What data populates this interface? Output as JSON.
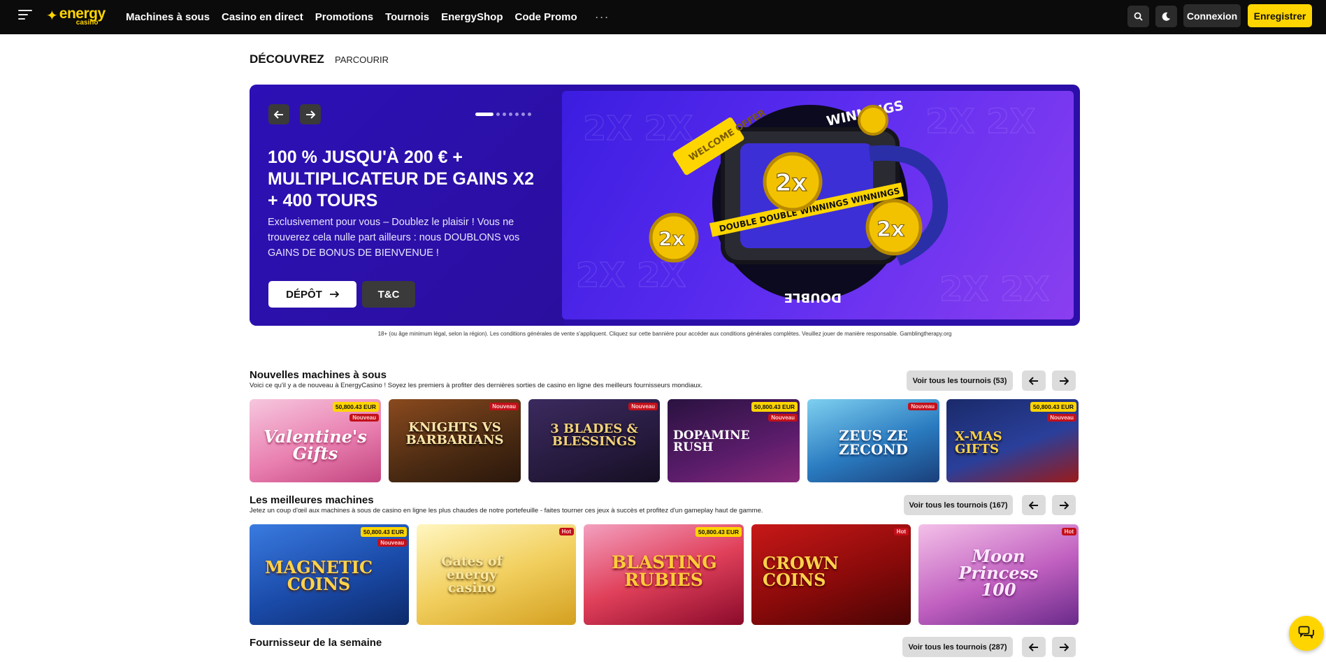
{
  "header": {
    "logo_main": "energy",
    "logo_sub": "casino",
    "nav": [
      "Machines à sous",
      "Casino en direct",
      "Promotions",
      "Tournois",
      "EnergyShop",
      "Code Promo"
    ],
    "more": "···",
    "login": "Connexion",
    "register": "Enregistrer"
  },
  "tabs": {
    "discover": "DÉCOUVREZ",
    "browse": "PARCOURIR"
  },
  "hero": {
    "title": "100 % JUSQU'À 200 € + MULTIPLICATEUR DE GAINS X2 + 400 TOURS",
    "text": "Exclusivement pour vous – Doublez le plaisir ! Vous ne trouverez cela nulle part ailleurs : nous DOUBLONS vos GAINS DE BONUS DE BIENVENUE !",
    "deposit": "DÉPÔT",
    "tc": "T&C",
    "art_ticket": "WELCOME OFFER",
    "art_word_top": "WINNINGS",
    "art_word_bottom": "DOUBLE",
    "art_tape": "DOUBLE DOUBLE WINNINGS WINNINGS",
    "art_coin": "2x",
    "slides": 7,
    "active_slide": 1,
    "disclaimer": "18+ (ou âge minimum légal, selon la région). Les conditions générales de vente s'appliquent. Cliquez sur cette bannière pour accéder aux conditions générales complètes. Veuillez jouer de manière responsable. Gamblingtherapy.org"
  },
  "new_slots": {
    "title": "Nouvelles machines à sous",
    "subtitle": "Voici ce qu'il y a de nouveau à EnergyCasino ! Soyez les premiers à profiter des dernières sorties de casino en ligne des meilleurs fournisseurs mondiaux.",
    "see_all": "Voir tous les tournois (53)",
    "games": [
      {
        "name": "Valentine's Gifts",
        "jackpot": "50,800.43 EUR",
        "tag": "Nouveau"
      },
      {
        "name": "KNIGHTS VS BARBARIANS",
        "jackpot": "",
        "tag": "Nouveau"
      },
      {
        "name": "3 BLADES & BLESSINGS",
        "jackpot": "",
        "tag": "Nouveau"
      },
      {
        "name": "DOPAMINE RUSH",
        "jackpot": "50,800.43 EUR",
        "tag": "Nouveau"
      },
      {
        "name": "ZEUS ZE ZECOND",
        "jackpot": "",
        "tag": "Nouveau"
      },
      {
        "name": "X-MAS GIFTS",
        "jackpot": "50,800.43 EUR",
        "tag": "Nouveau"
      }
    ]
  },
  "top_slots": {
    "title": "Les meilleures machines",
    "subtitle": "Jetez un coup d'œil aux machines à sous de casino en ligne les plus chaudes de notre portefeuille - faites tourner ces jeux à succès et profitez d'un gameplay haut de gamme.",
    "see_all": "Voir tous les tournois (167)",
    "games": [
      {
        "name": "MAGNETIC COINS",
        "jackpot": "50,800.43 EUR",
        "tag": "Nouveau"
      },
      {
        "name": "Gates of energy casino",
        "jackpot": "",
        "tag": "Hot"
      },
      {
        "name": "BLASTING RUBIES",
        "jackpot": "50,800.43 EUR",
        "tag": ""
      },
      {
        "name": "CROWN COINS",
        "jackpot": "",
        "tag": "Hot"
      },
      {
        "name": "Moon Princess 100",
        "jackpot": "",
        "tag": "Hot"
      }
    ]
  },
  "provider": {
    "title": "Fournisseur de la semaine",
    "see_all": "Voir tous les tournois (287)"
  },
  "colors": {
    "brand": "#ffd500",
    "topbar": "#0b0b0b",
    "hero": "#2b0fa8",
    "hot": "#c3101a"
  },
  "icons": [
    "menu-icon",
    "search-icon",
    "moon-icon",
    "arrow-left-icon",
    "arrow-right-icon",
    "chat-icon"
  ]
}
